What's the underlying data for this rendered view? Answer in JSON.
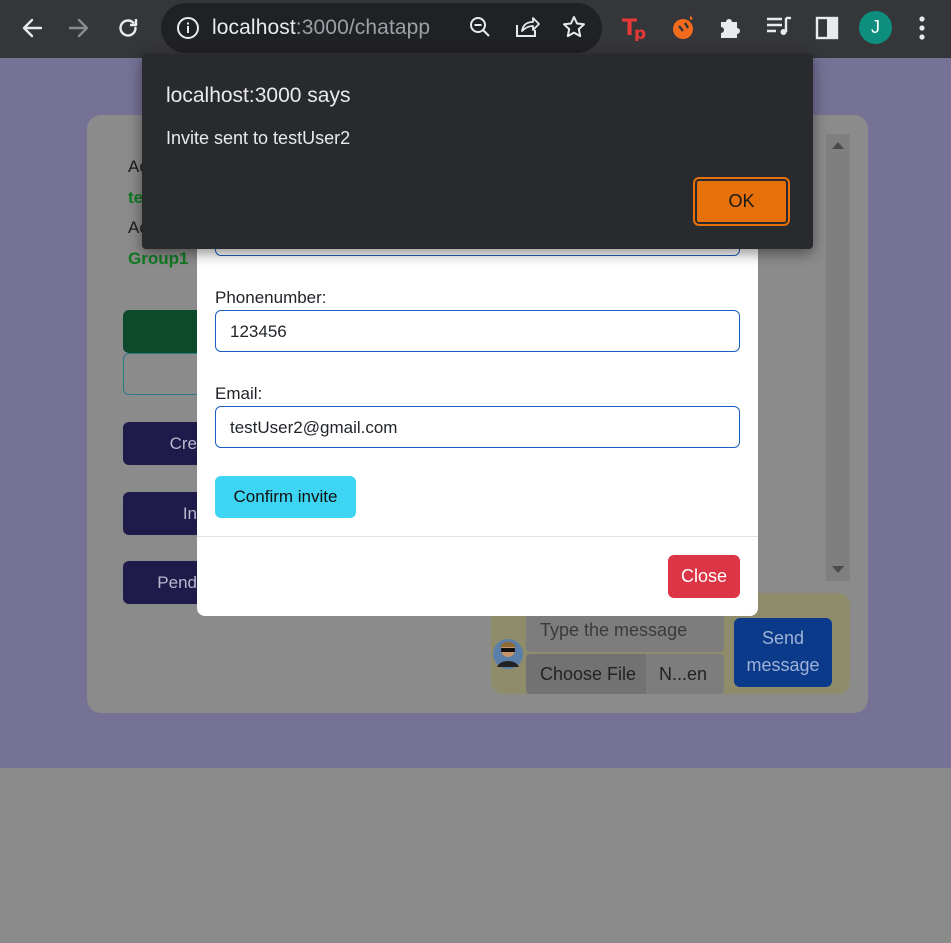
{
  "browser": {
    "url_host": "localhost",
    "url_path": ":3000/chatapp",
    "profile_initial": "J",
    "icons": [
      "back-arrow",
      "forward-arrow",
      "reload",
      "site-info",
      "zoom",
      "share",
      "bookmark-star",
      "tp-extension",
      "fire-extension",
      "extensions-puzzle",
      "media-queue",
      "side-panel",
      "menu-dots"
    ]
  },
  "alert": {
    "title": "localhost:3000 says",
    "message": "Invite sent to testUser2",
    "ok_label": "OK"
  },
  "modal": {
    "phone_label": "Phonenumber:",
    "phone_value": "123456",
    "email_label": "Email:",
    "email_value": "testUser2@gmail.com",
    "confirm_label": "Confirm invite",
    "close_label": "Close"
  },
  "background": {
    "text1": "Ac",
    "green1": "te",
    "text2": "Ac",
    "green2": "Group1",
    "btn_create": "Cre",
    "btn_invite": "In",
    "btn_pending": "Pend",
    "message_placeholder": "Type the message",
    "choose_file": "Choose File",
    "file_name": "N...en",
    "send_label": "Send message"
  },
  "colors": {
    "chrome_bg": "#35363a",
    "alert_bg": "#292a2d",
    "ok_orange": "#e6700a",
    "confirm_cyan": "#3dd5f3",
    "close_red": "#dc3545"
  }
}
